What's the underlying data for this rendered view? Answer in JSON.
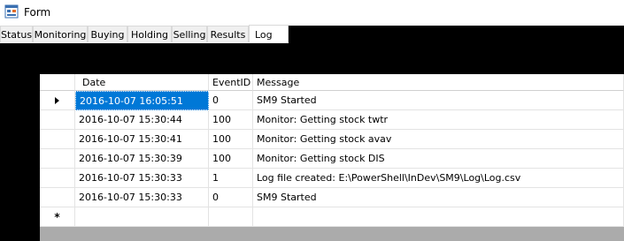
{
  "window": {
    "title": "Form"
  },
  "tabs": [
    "Status",
    "Monitoring",
    "Buying",
    "Holding",
    "Selling",
    "Results",
    "Log"
  ],
  "active_tab": "Log",
  "grid": {
    "columns": [
      "Date",
      "EventID",
      "Message"
    ],
    "rows": [
      {
        "date": "2016-10-07 16:05:51",
        "event_id": "0",
        "message": "SM9 Started"
      },
      {
        "date": "2016-10-07 15:30:44",
        "event_id": "100",
        "message": "Monitor: Getting stock twtr"
      },
      {
        "date": "2016-10-07 15:30:41",
        "event_id": "100",
        "message": "Monitor: Getting stock avav"
      },
      {
        "date": "2016-10-07 15:30:39",
        "event_id": "100",
        "message": "Monitor: Getting stock DIS"
      },
      {
        "date": "2016-10-07 15:30:33",
        "event_id": "1",
        "message": "Log file created: E:\\PowerShell\\InDev\\SM9\\Log\\Log.csv"
      },
      {
        "date": "2016-10-07 15:30:33",
        "event_id": "0",
        "message": "SM9 Started"
      }
    ],
    "new_row_marker": "*",
    "current_row_marker": "arrow-right-icon"
  },
  "colors": {
    "selection": "#0078d7",
    "background": "#000000",
    "grid_empty": "#ababab"
  }
}
